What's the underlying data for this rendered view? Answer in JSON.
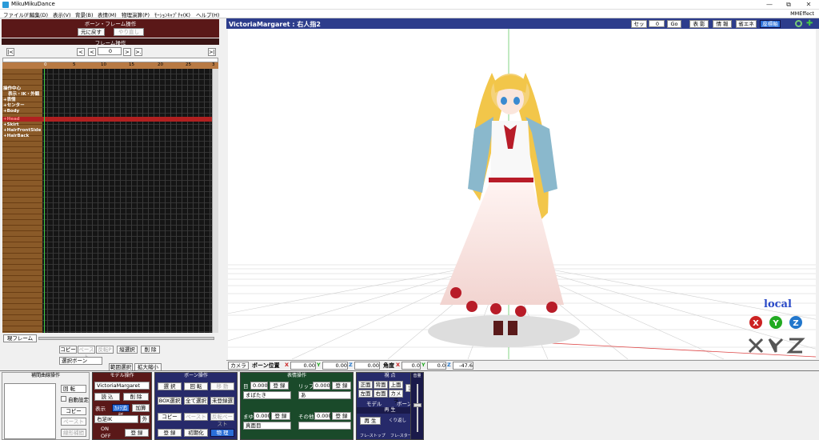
{
  "window": {
    "title": "MikuMikuDance",
    "minimize": "—",
    "maximize": "⧉",
    "close": "✕"
  },
  "menu": [
    "ファイル(F)",
    "編集(D)",
    "表示(V)",
    "背景(B)",
    "表情(M)",
    "物理演算(P)",
    "ﾓｰｼｮﾝｷｬﾌﾟﾁｬ(K)",
    "ヘルプ(H)"
  ],
  "menu_right": "MMEffect",
  "bone_frame": {
    "title": "ボーン・フレーム操作",
    "undo": "元に戻す",
    "redo": "やり直し"
  },
  "frame_op": {
    "title": "フレーム操作",
    "frame": "0",
    "first": "|<",
    "prev_key": "<",
    "prev": "<",
    "next": ">",
    "next_key": ">.",
    "last": ">|"
  },
  "timeline": {
    "ticks": [
      "0",
      "5",
      "10",
      "15",
      "20",
      "25",
      "3"
    ],
    "tracks": [
      "操作中心",
      "表示・IK・外観",
      "+表情",
      "+センター",
      "+Body",
      "+Head",
      "+Skirt",
      "+HairFrontSide",
      "+HairBack"
    ]
  },
  "frame_tools": {
    "current": "現フレーム",
    "copy": "コピー",
    "paste": "ペースト",
    "reverse": "反転P",
    "select_vert": "縦選択",
    "delete": "削 除",
    "select_bone": "選択ボーン",
    "range_select": "範囲選択",
    "zoom": "拡大縮小"
  },
  "viewport": {
    "model": "VictoriaMargaret : 右人指2",
    "set": "セット",
    "frame": "0",
    "go": "Go",
    "shadow": "表 影",
    "info": "情 報",
    "power_save": "省エネ",
    "playback": "座標軸",
    "local": "local",
    "axes": [
      "X",
      "Y",
      "Z"
    ]
  },
  "status": {
    "camera": "カメラ編",
    "bone_pos": "ボーン位置",
    "x": "0.00",
    "y": "0.00",
    "z": "0.00",
    "angle": "角度",
    "ax": "0.0",
    "ay": "0.0",
    "az": "-47.6"
  },
  "interp": {
    "title": "補間曲線操作",
    "rotate": "回 転",
    "auto": "自動設定",
    "copy": "コピー",
    "paste": "ペースト",
    "linear": "線形補間"
  },
  "model_op": {
    "title": "モデル操作",
    "model": "VictoriaMargaret",
    "load": "読 込",
    "delete": "削 除",
    "show": "表示",
    "add": "加算",
    "blend": "ｶﾒﾗ追従",
    "bone": "右足IK",
    "outer": "外",
    "on": "ON",
    "off": "OFF",
    "register": "登 録"
  },
  "bone_op": {
    "title": "ボーン操作",
    "select": "選 択",
    "rotate": "回 転",
    "move": "移 動",
    "box": "BOX選択",
    "all": "全て選択",
    "unreg": "未登録選",
    "copy": "コピー",
    "paste": "ペースト",
    "rev": "反転ペースト",
    "register": "登 録",
    "init": "初期化",
    "physics": "物 理"
  },
  "facial": {
    "title": "表情操作",
    "eye": "目",
    "lip": "リップ",
    "brow": "まゆ",
    "other": "その他",
    "v": "0.000",
    "reg": "登 録",
    "eye_sel": "まばたき",
    "lip_sel": "あ",
    "brow_sel": "真面目",
    "other_sel": ""
  },
  "view": {
    "title": "視 点",
    "front": "正面",
    "back": "背面",
    "top": "上面",
    "left": "左面",
    "right": "右面",
    "camera": "カメラ",
    "follow": "追従",
    "model": "モデル",
    "bone": "ボーン"
  },
  "play": {
    "title": "再 生",
    "play": "再 生",
    "repeat": "くり返し",
    "frame_stop": "フレ-ストップ",
    "frame_start": "フレ-スタート",
    "volume": "音量"
  }
}
